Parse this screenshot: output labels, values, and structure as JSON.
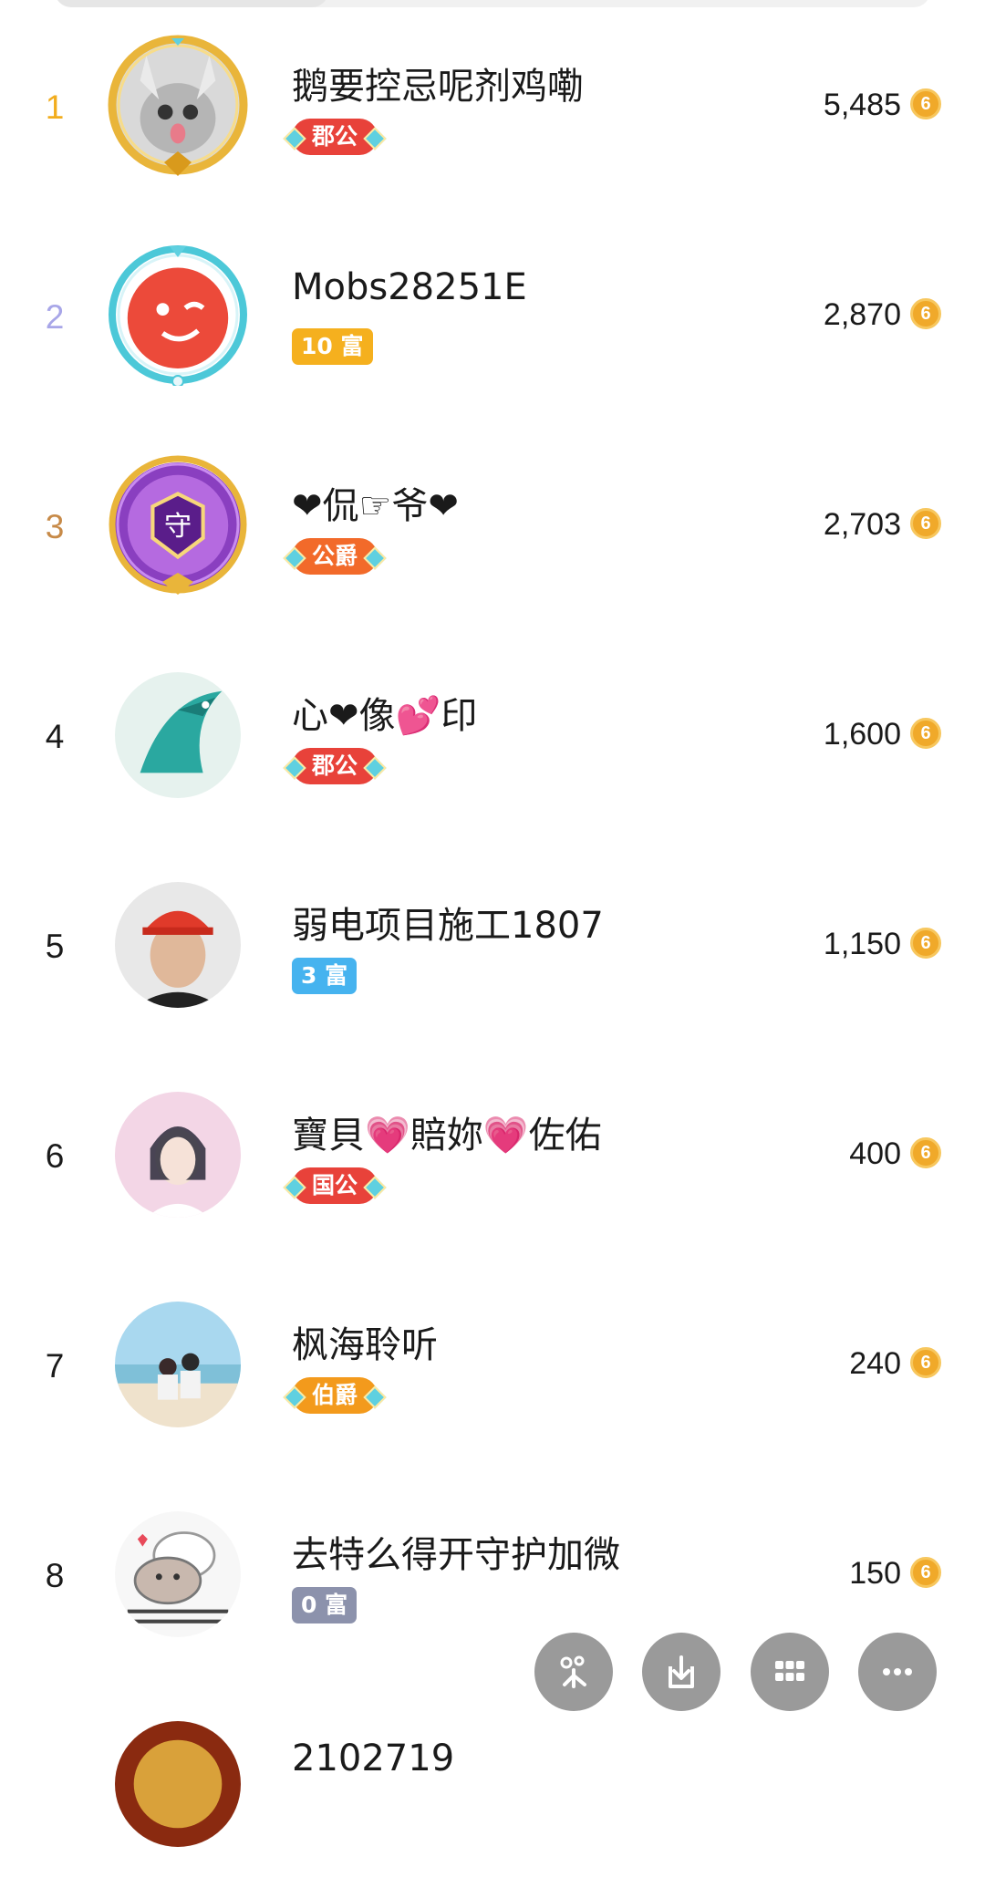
{
  "colors": {
    "rank1": "#f2ad1e",
    "rank2": "#a8a6e8",
    "rank3": "#c78a48",
    "rank_default": "#1a1a1a",
    "coin": "#f0a92a"
  },
  "rows": [
    {
      "rank": "1",
      "name": "鹅要控忌呢剂鸡嘞",
      "badge": "郡公",
      "badge_type": "noble",
      "badge_color": "#e8423a",
      "score": "5,485",
      "coin_icon": "coin-icon"
    },
    {
      "rank": "2",
      "name": "Mobs28251E",
      "badge": "10 富",
      "badge_type": "wealth",
      "badge_color": "#f5b01e",
      "score": "2,870",
      "coin_icon": "coin-icon"
    },
    {
      "rank": "3",
      "name": "❤侃☞爷❤",
      "badge": "公爵",
      "badge_type": "noble",
      "badge_color": "#f26a2a",
      "score": "2,703",
      "coin_icon": "coin-icon"
    },
    {
      "rank": "4",
      "name": "心❤像💕印",
      "badge": "郡公",
      "badge_type": "noble",
      "badge_color": "#e8423a",
      "score": "1,600",
      "coin_icon": "coin-icon"
    },
    {
      "rank": "5",
      "name": "弱电项目施工1807",
      "badge": "3 富",
      "badge_type": "wealth",
      "badge_color": "#46b3ef",
      "score": "1,150",
      "coin_icon": "coin-icon"
    },
    {
      "rank": "6",
      "name": "寶貝💗賠妳💗佐佑",
      "badge": "国公",
      "badge_type": "noble",
      "badge_color": "#e8423a",
      "score": "400",
      "coin_icon": "coin-icon"
    },
    {
      "rank": "7",
      "name": "枫海聆听",
      "badge": "伯爵",
      "badge_type": "noble",
      "badge_color": "#f39a1c",
      "score": "240",
      "coin_icon": "coin-icon"
    },
    {
      "rank": "8",
      "name": "去特么得开守护加微",
      "badge": "0 富",
      "badge_type": "wealth",
      "badge_color": "#8c92ac",
      "score": "150",
      "coin_icon": "coin-icon"
    },
    {
      "rank": "",
      "name": "2102719",
      "badge": "",
      "badge_type": "",
      "badge_color": "",
      "score": "",
      "coin_icon": ""
    }
  ],
  "floating_buttons": [
    {
      "icon": "kuaishou-logo-icon"
    },
    {
      "icon": "download-icon"
    },
    {
      "icon": "grid-icon"
    },
    {
      "icon": "more-icon"
    }
  ]
}
